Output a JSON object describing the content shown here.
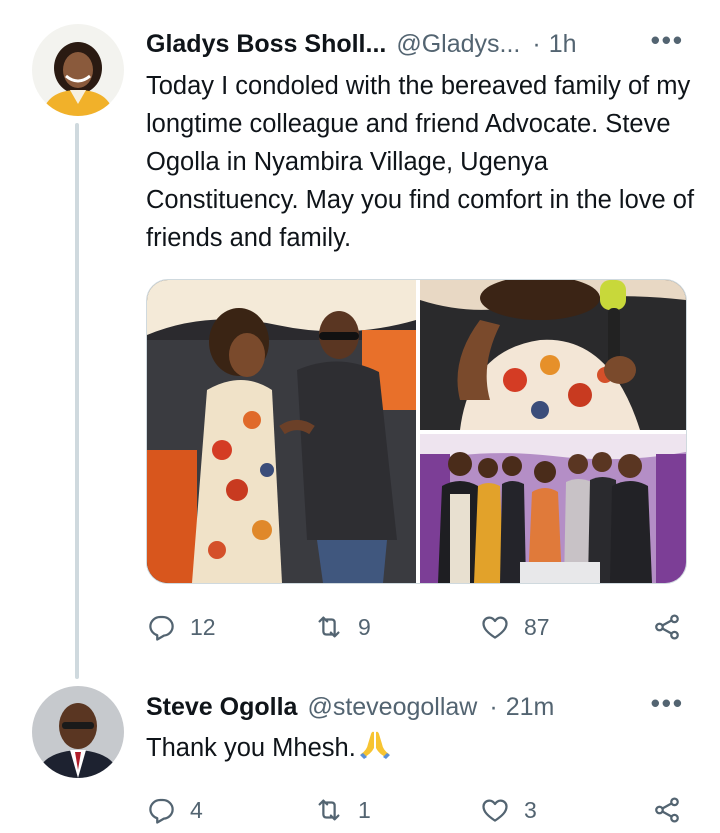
{
  "tweets": [
    {
      "author_name": "Gladys Boss Sholl...",
      "handle": "@Gladys...",
      "separator": "·",
      "time": "1h",
      "more_label": "•••",
      "text": "Today I condoled with the bereaved family of my longtime colleague and friend Advocate. Steve Ogolla in Nyambira Village, Ugenya Constituency. May you find comfort in the love of friends and family.",
      "replies": "12",
      "retweets": "9",
      "likes": "87",
      "photos": [
        "woman-and-man-conversing-photo",
        "woman-with-microphone-photo",
        "group-photo"
      ]
    },
    {
      "author_name": "Steve Ogolla",
      "handle": "@steveogollaw",
      "separator": "·",
      "time": "21m",
      "more_label": "•••",
      "text": "Thank you Mhesh.",
      "emoji": "folded-hands-emoji",
      "replies": "4",
      "retweets": "1",
      "likes": "3"
    }
  ],
  "icons": {
    "reply": "reply-icon",
    "retweet": "retweet-icon",
    "like": "heart-icon",
    "share": "share-icon"
  },
  "colors": {
    "text_primary": "#0f1419",
    "text_secondary": "#536471",
    "thread_line": "#cfd9de",
    "media_border": "#cfd9de",
    "emoji_yellow": "#f7c432"
  }
}
